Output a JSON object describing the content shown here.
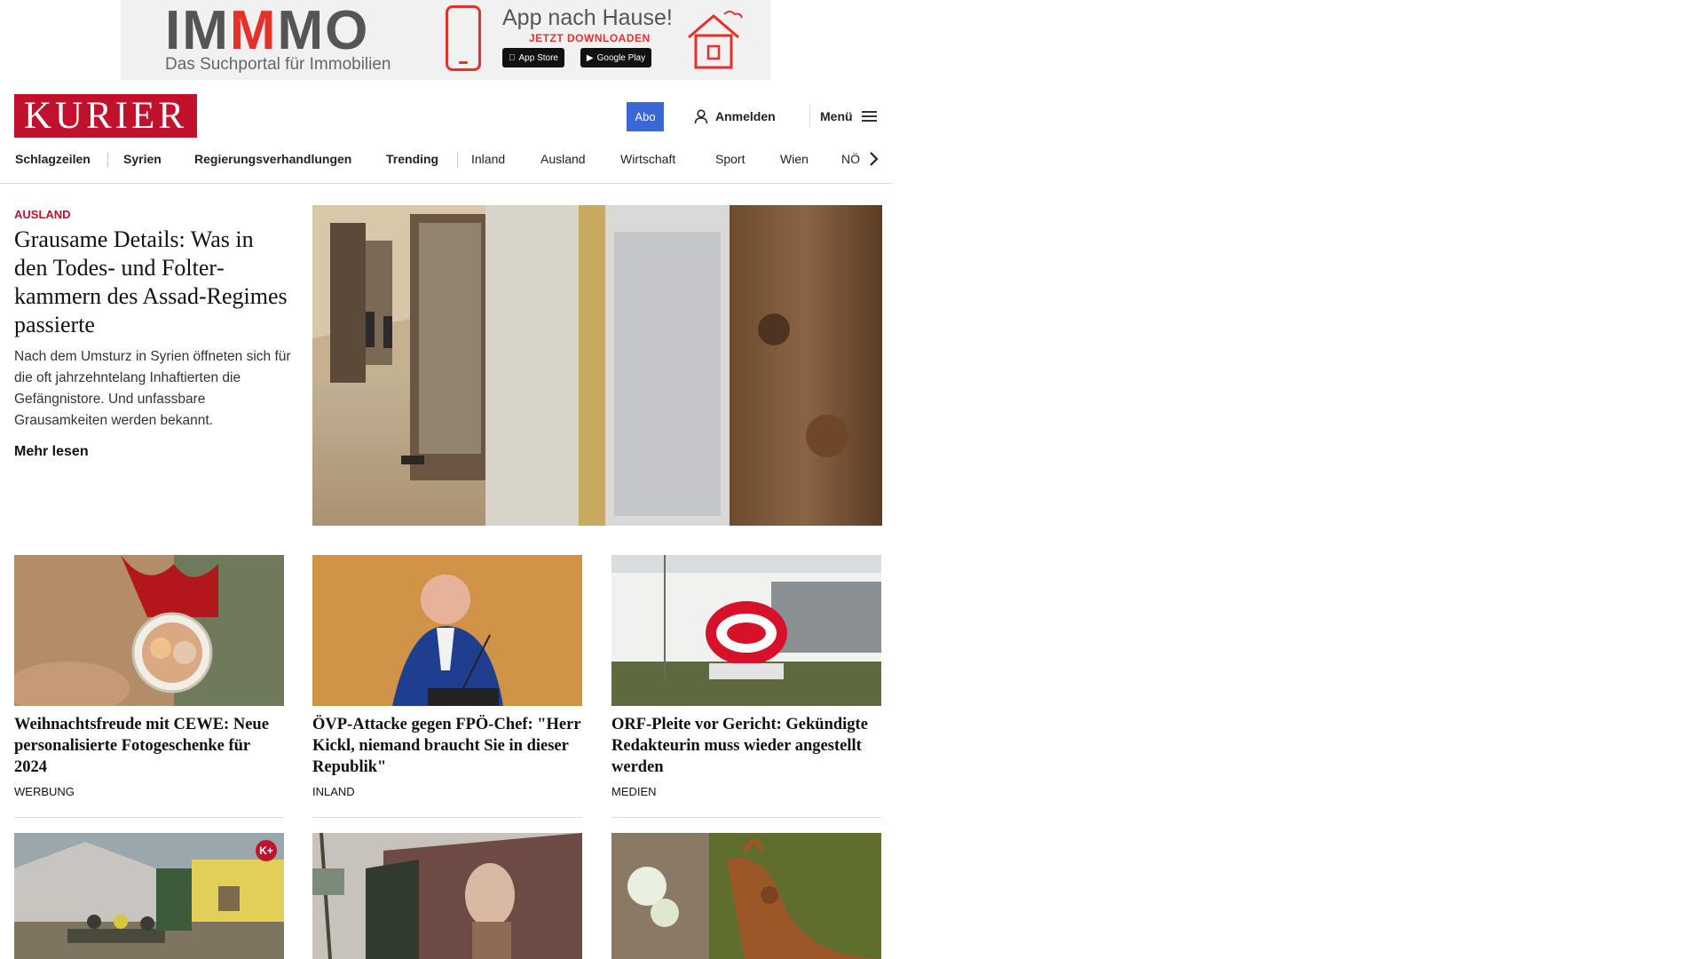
{
  "ad": {
    "brand_pre": "IM",
    "brand_accent": "M",
    "brand_post": "MO",
    "tagline": "Das Suchportal für Immobilien",
    "headline": "App nach Hause!",
    "subline": "JETZT DOWNLOADEN",
    "apple_label": "App Store",
    "google_label": "Google Play"
  },
  "header": {
    "logo": "KURIER",
    "abo": "Abo",
    "login": "Anmelden",
    "menu": "Menü"
  },
  "nav": {
    "items": [
      "Schlagzeilen",
      "Syrien",
      "Regierungsverhandlungen",
      "Trending",
      "Inland",
      "Ausland",
      "Wirtschaft",
      "Sport",
      "Wien",
      "NÖ"
    ]
  },
  "lead": {
    "kicker": "AUSLAND",
    "title": "Grausame Details: Was in den Todes- und Folter­kammern des Assad-Re­gimes passierte",
    "teaser": "Nach dem Umsturz in Syrien öffneten sich für die oft jahrzehntelang Inhaftierten die Gefängnistore. Und unfassbare Grausamkeiten werden bekannt.",
    "more": "Mehr lesen"
  },
  "cards": [
    {
      "title": "Weihnachtsfreude mit CEWE: Neue personalisierte Fotogeschenke für 2024",
      "kicker": "WERBUNG"
    },
    {
      "title": "ÖVP-Attacke gegen FPÖ-Chef: \"Herr Kickl, niemand braucht Sie in dieser Republik\"",
      "kicker": "INLAND"
    },
    {
      "title": "ORF-Pleite vor Gericht: Gekündigte Redakteurin muss wieder ange­stellt werden",
      "kicker": "MEDIEN"
    }
  ],
  "kplus_badge": "K+",
  "colors": {
    "brand_red": "#c0122c",
    "abo_blue": "#3a66d6",
    "ad_accent": "#e8302b"
  },
  "icons": {
    "login": "user-icon",
    "menu": "hamburger-icon",
    "nav_next": "chevron-right-icon"
  }
}
